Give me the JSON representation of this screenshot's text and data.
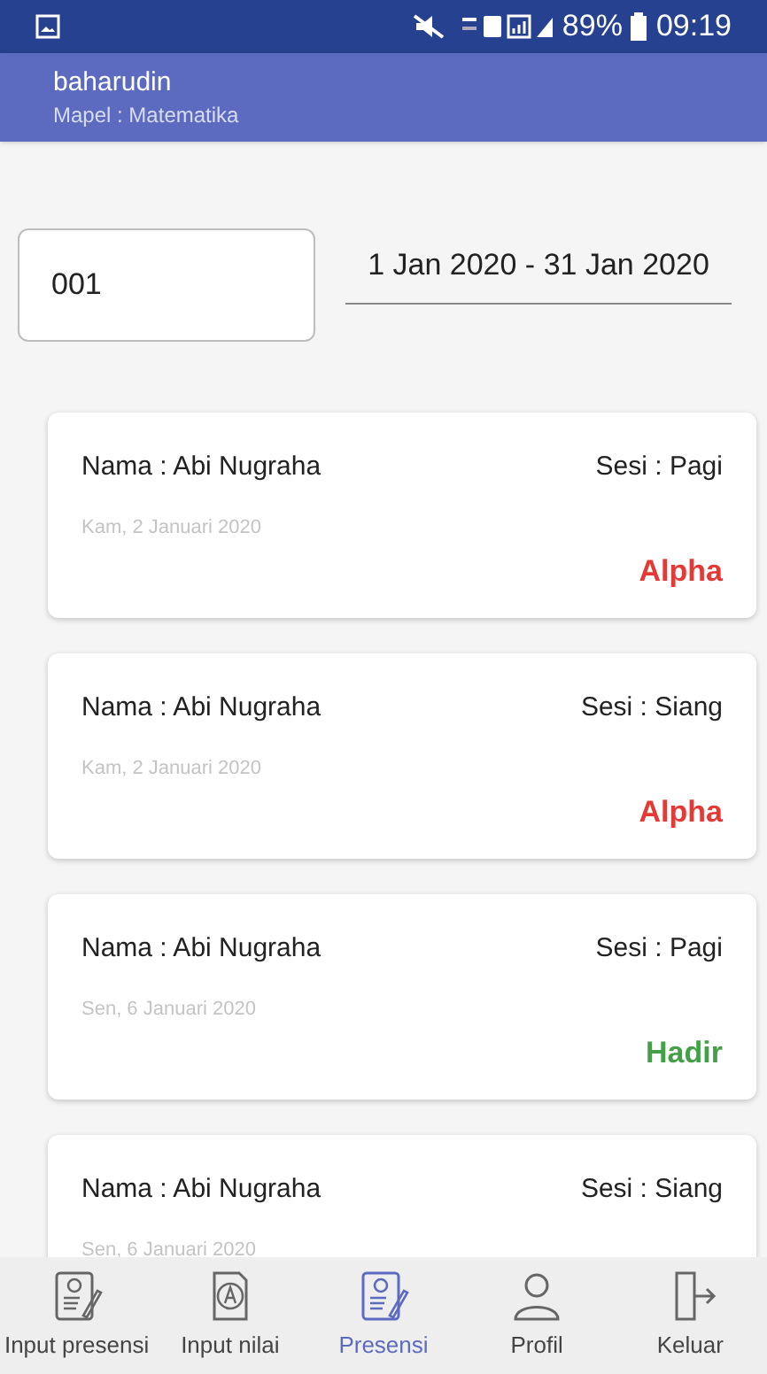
{
  "status_bar": {
    "battery": "89%",
    "time": "09:19"
  },
  "app_bar": {
    "title": "baharudin",
    "subtitle": "Mapel : Matematika"
  },
  "filter": {
    "code_value": "001",
    "date_range": "1 Jan 2020 - 31 Jan 2020"
  },
  "records": [
    {
      "name": "Nama : Abi Nugraha",
      "session": "Sesi : Pagi",
      "date": "Kam, 2 Januari 2020",
      "status": "Alpha",
      "color": "#e53935"
    },
    {
      "name": "Nama : Abi Nugraha",
      "session": "Sesi : Siang",
      "date": "Kam, 2 Januari 2020",
      "status": "Alpha",
      "color": "#e53935"
    },
    {
      "name": "Nama : Abi Nugraha",
      "session": "Sesi : Pagi",
      "date": "Sen, 6 Januari 2020",
      "status": "Hadir",
      "color": "#43a047"
    },
    {
      "name": "Nama : Abi Nugraha",
      "session": "Sesi : Siang",
      "date": "Sen, 6 Januari 2020"
    }
  ],
  "bottom_nav": [
    {
      "label": "Input presensi",
      "kind": "form",
      "selected": false
    },
    {
      "label": "Input nilai",
      "kind": "grade",
      "selected": false
    },
    {
      "label": "Presensi",
      "kind": "form",
      "selected": true
    },
    {
      "label": "Profil",
      "kind": "person",
      "selected": false
    },
    {
      "label": "Keluar",
      "kind": "exit",
      "selected": false
    }
  ]
}
